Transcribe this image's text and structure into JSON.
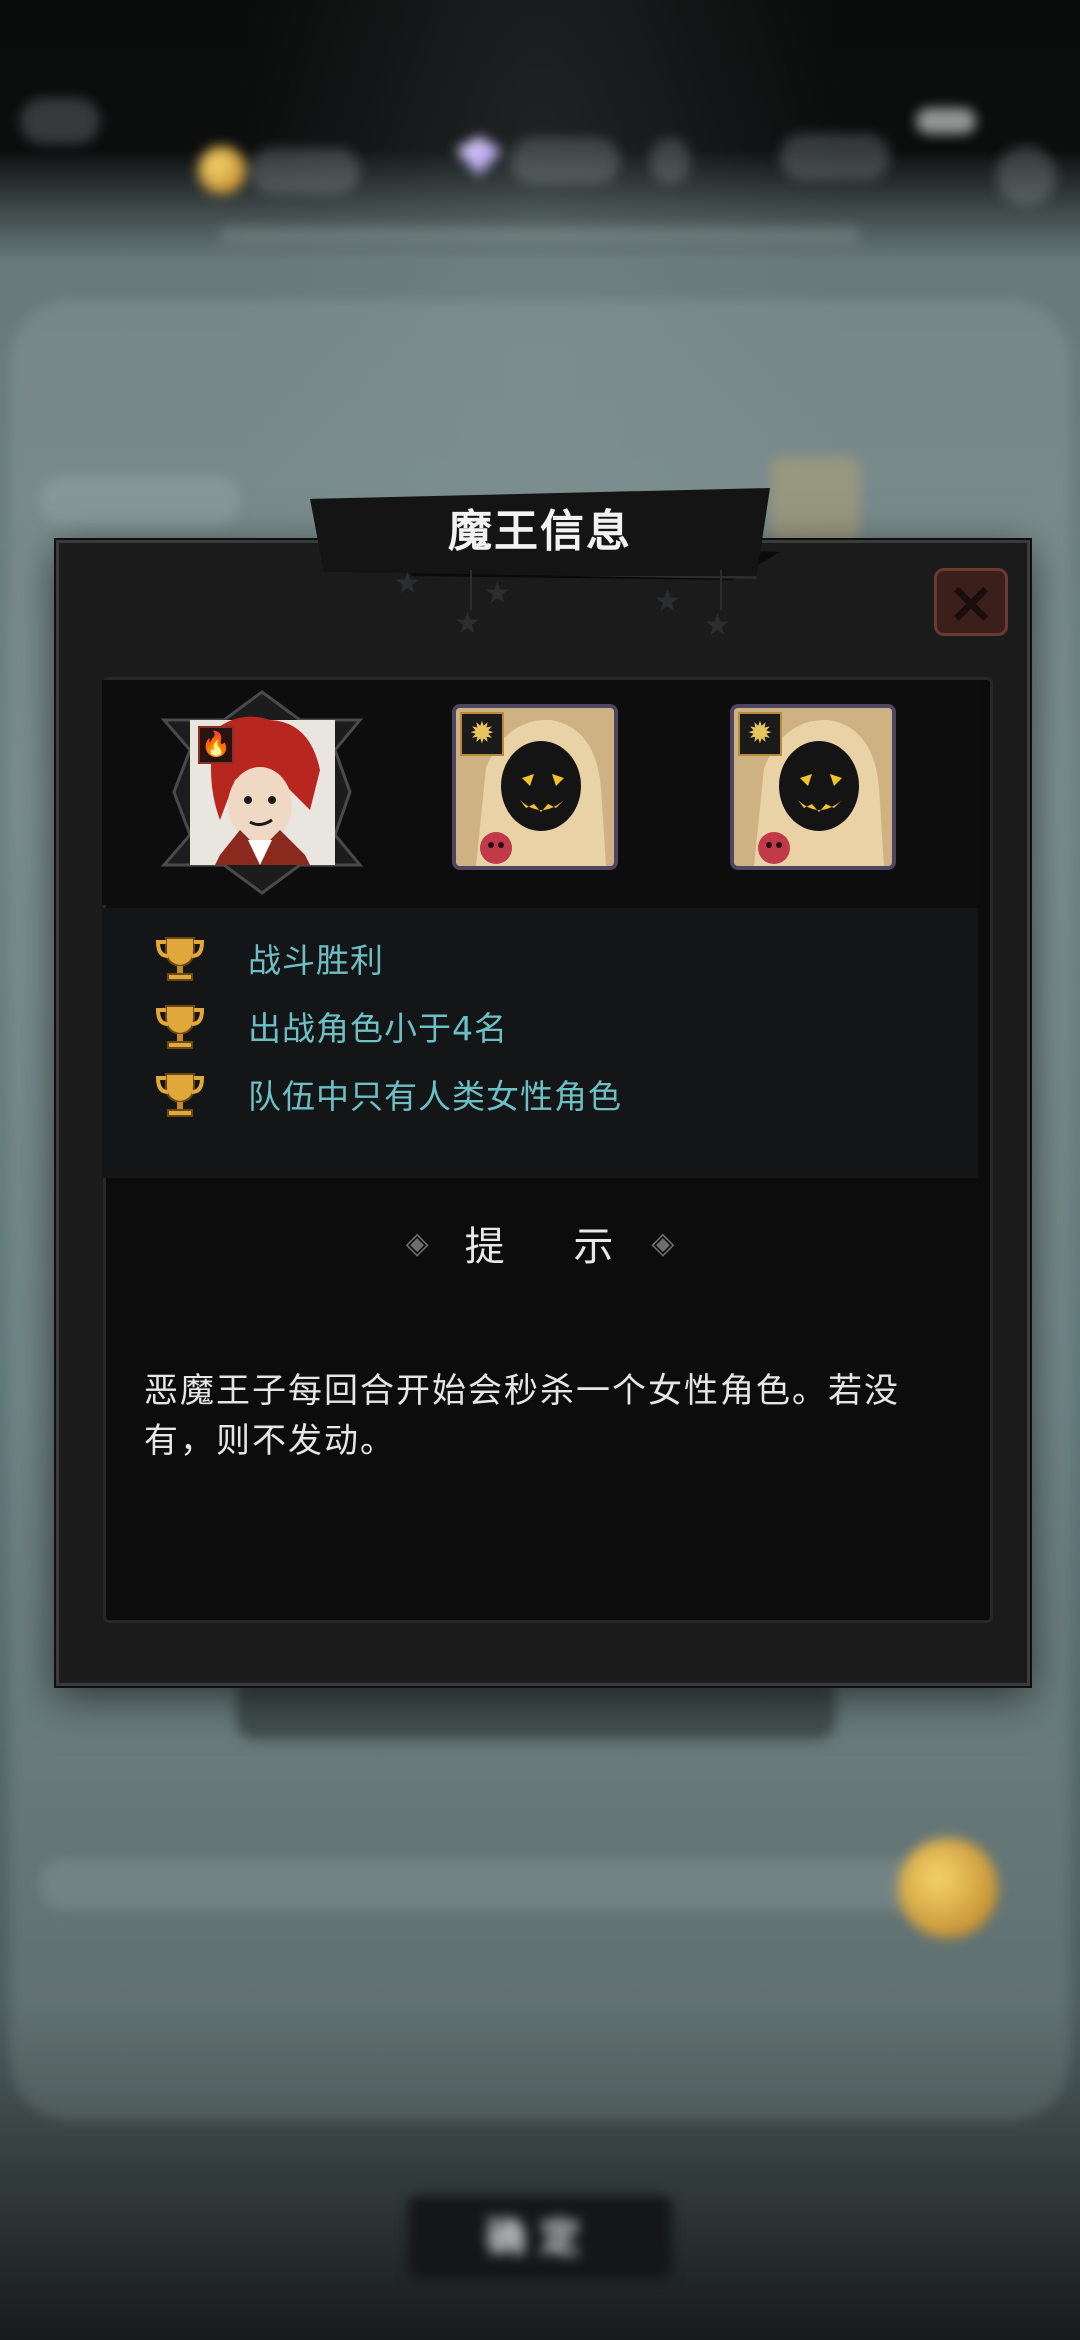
{
  "dialog": {
    "title": "魔王信息",
    "close_icon": "close-x-icon"
  },
  "boss": {
    "portrait_icon": "demon-prince-portrait",
    "element_icon": "fire-element-icon"
  },
  "minions": [
    {
      "portrait_icon": "hooded-cultist-portrait",
      "element_icon": "light-element-icon"
    },
    {
      "portrait_icon": "hooded-cultist-portrait",
      "element_icon": "light-element-icon"
    }
  ],
  "conditions": [
    {
      "icon": "trophy-icon",
      "text": "战斗胜利"
    },
    {
      "icon": "trophy-icon",
      "text": "出战角色小于4名"
    },
    {
      "icon": "trophy-icon",
      "text": "队伍中只有人类女性角色"
    }
  ],
  "hint": {
    "title": "提 示",
    "line1": "恶魔王子每回合开始会秒杀一个女性角色。若没",
    "line2": "有，则不发动。"
  },
  "background": {
    "confirm_label": "确定"
  },
  "colors": {
    "condition_text": "#6cc0c4",
    "close_button": "#6b3a2f",
    "minion_frame": "#4e4660",
    "element_badge_border": "#b88a3a"
  }
}
